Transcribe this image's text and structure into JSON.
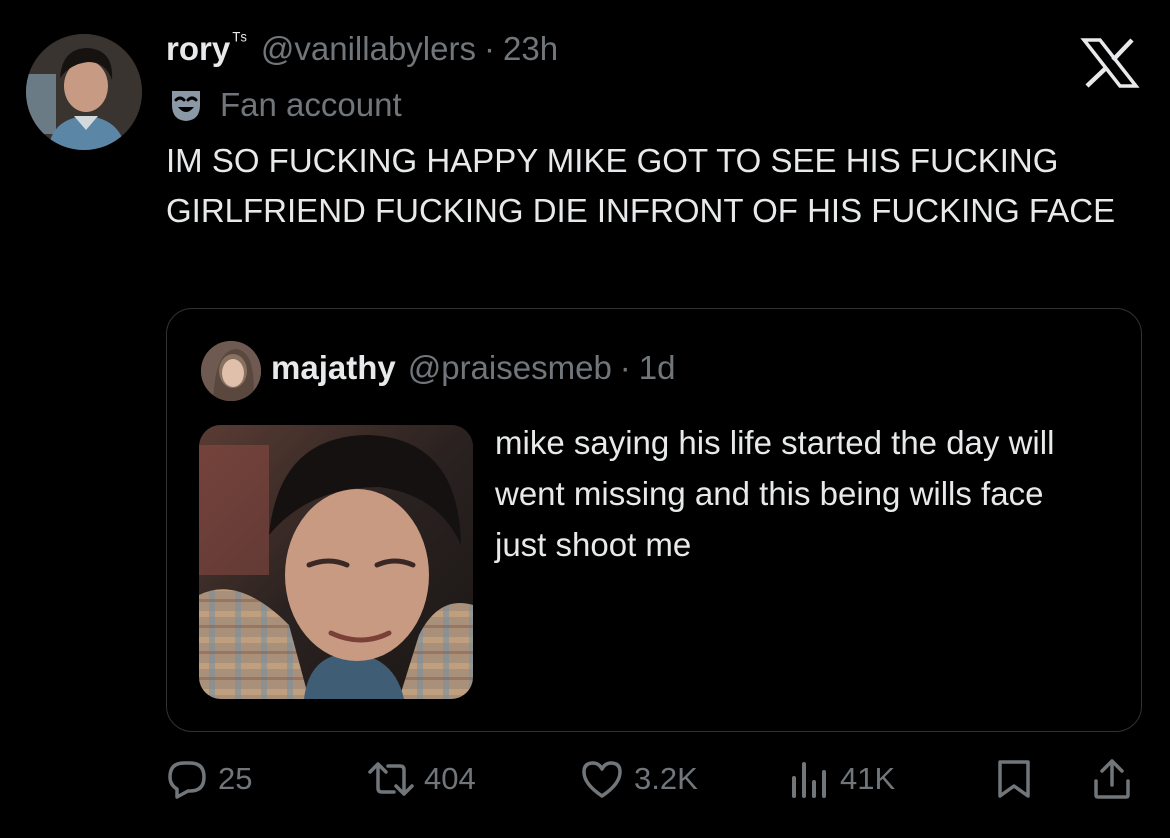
{
  "tweet": {
    "display_name": "rory",
    "name_suffix": "ᵀˢ",
    "handle": "@vanillabylers",
    "separator": "·",
    "time": "23h",
    "label_icon": "theater-masks-icon",
    "label": "Fan account",
    "text": "IM SO FUCKING HAPPY MIKE GOT TO SEE HIS FUCKING GIRLFRIEND FUCKING DIE INFRONT OF HIS FUCKING FACE"
  },
  "quote": {
    "display_name": "majathy",
    "handle": "@praisesmeb",
    "separator": "·",
    "time": "1d",
    "text": "mike saying his life started the day will went missing and this being wills face just shoot me"
  },
  "actions": {
    "replies": "25",
    "reposts": "404",
    "likes": "3.2K",
    "views": "41K"
  },
  "icons": {
    "brand": "x-logo-icon",
    "reply": "speech-bubble-icon",
    "repost": "repost-arrows-icon",
    "like": "heart-icon",
    "views": "bar-chart-icon",
    "bookmark": "bookmark-icon",
    "share": "share-arrow-icon"
  },
  "colors": {
    "background": "#000000",
    "text_primary": "#e7e9ea",
    "text_secondary": "#71767b",
    "border": "#2f3336"
  }
}
